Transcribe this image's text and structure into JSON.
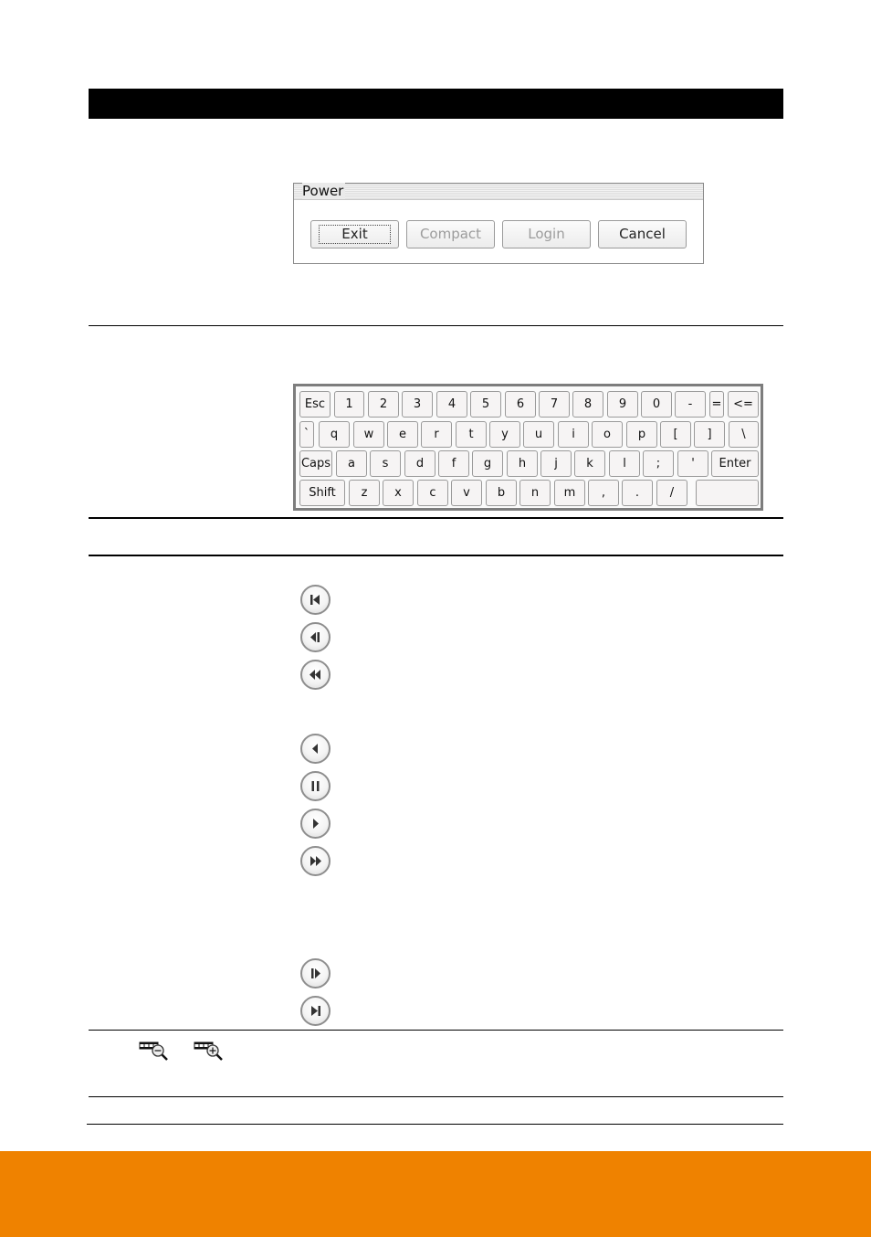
{
  "colors": {
    "header_bar": "#000000",
    "footer_band": "#EF8200",
    "rule": "#000000"
  },
  "power_dialog": {
    "title": "Power",
    "buttons": [
      {
        "label": "Exit",
        "state": "focused"
      },
      {
        "label": "Compact",
        "state": "disabled"
      },
      {
        "label": "Login",
        "state": "disabled"
      },
      {
        "label": "Cancel",
        "state": "enabled"
      }
    ]
  },
  "keyboard": {
    "rows": [
      [
        "Esc",
        "1",
        "2",
        "3",
        "4",
        "5",
        "6",
        "7",
        "8",
        "9",
        "0",
        "-",
        "=",
        "<="
      ],
      [
        "`",
        "q",
        "w",
        "e",
        "r",
        "t",
        "y",
        "u",
        "i",
        "o",
        "p",
        "[",
        "]",
        "\\"
      ],
      [
        "Caps",
        "a",
        "s",
        "d",
        "f",
        "g",
        "h",
        "j",
        "k",
        "l",
        ";",
        "'",
        "Enter"
      ],
      [
        "Shift",
        "z",
        "x",
        "c",
        "v",
        "b",
        "n",
        "m",
        ",",
        ".",
        "/",
        ""
      ]
    ]
  },
  "playback_buttons": [
    {
      "icon": "skip-to-start-icon"
    },
    {
      "icon": "step-backward-icon"
    },
    {
      "icon": "fast-rewind-icon"
    },
    {
      "icon": "play-reverse-icon"
    },
    {
      "icon": "pause-icon"
    },
    {
      "icon": "play-icon"
    },
    {
      "icon": "fast-forward-icon"
    },
    {
      "icon": "step-forward-icon"
    },
    {
      "icon": "skip-to-end-icon"
    }
  ],
  "zoom_icons": [
    {
      "icon": "timeline-zoom-out-icon"
    },
    {
      "icon": "timeline-zoom-in-icon"
    }
  ]
}
